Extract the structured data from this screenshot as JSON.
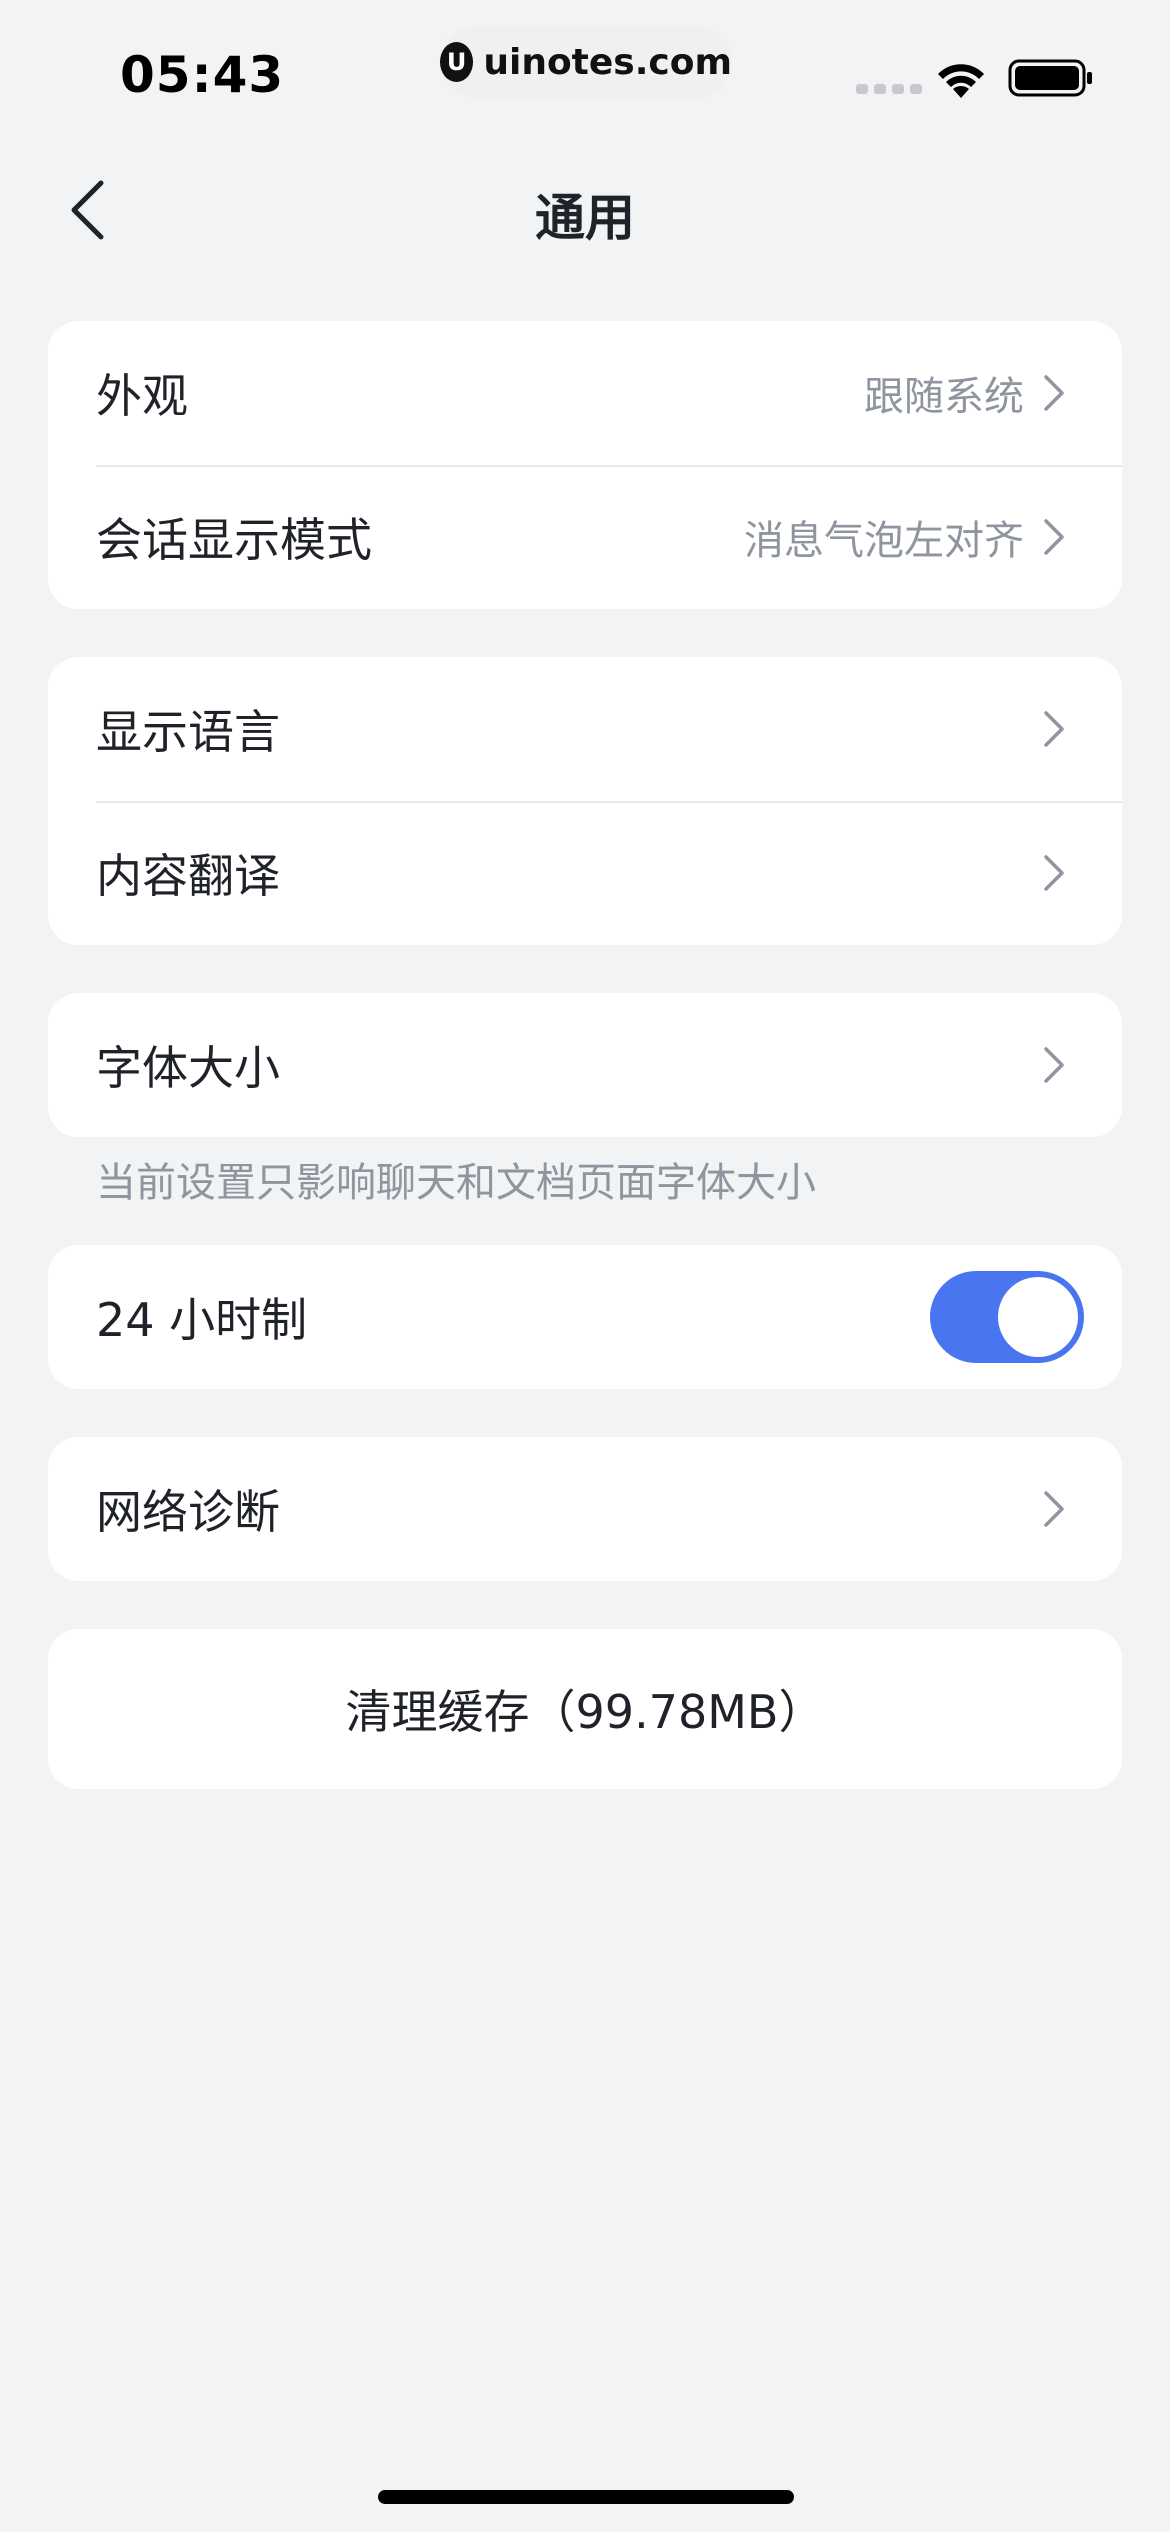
{
  "status_bar": {
    "time": "05:43",
    "url": "uinotes.com",
    "url_logo_glyph": "U"
  },
  "nav": {
    "title": "通用",
    "back_icon": "chevron-left-icon"
  },
  "groups": {
    "display": {
      "appearance_label": "外观",
      "appearance_value": "跟随系统",
      "chat_mode_label": "会话显示模式",
      "chat_mode_value": "消息气泡左对齐"
    },
    "language": {
      "display_language_label": "显示语言",
      "content_translation_label": "内容翻译"
    },
    "font": {
      "font_size_label": "字体大小",
      "hint": "当前设置只影响聊天和文档页面字体大小"
    },
    "time_format": {
      "label": "24 小时制",
      "enabled": true
    },
    "network": {
      "label": "网络诊断"
    }
  },
  "clear_cache_label": "清理缓存（99.78MB）",
  "colors": {
    "background": "#f2f3f5",
    "card": "#ffffff",
    "toggle_on": "#4a75f0",
    "secondary_text": "#8f959e"
  }
}
